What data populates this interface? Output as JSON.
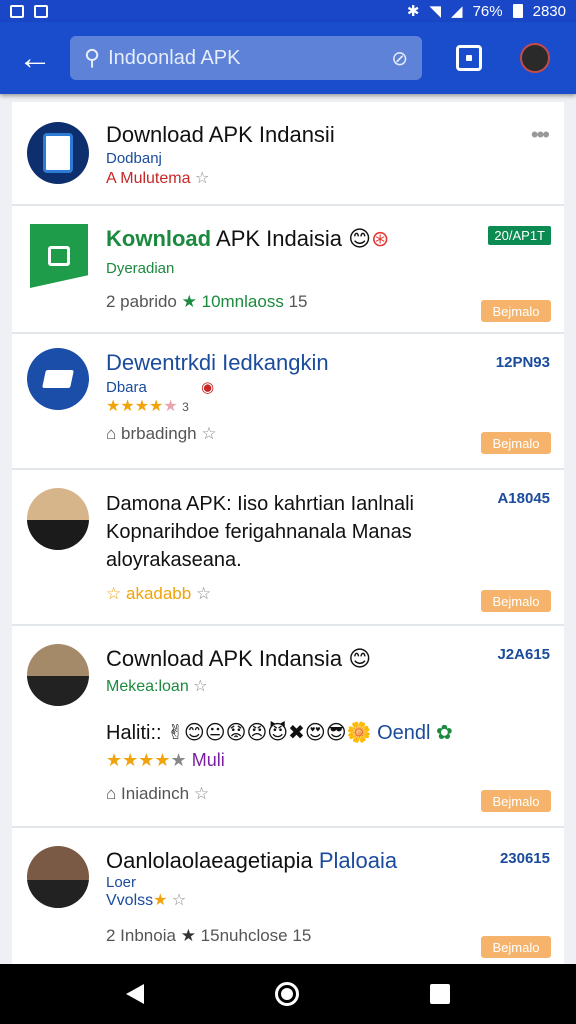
{
  "status": {
    "battery": "76%",
    "time": "2830"
  },
  "search": {
    "text": "Indoonlad APK"
  },
  "items": [
    {
      "title": "Download APK Indansii",
      "sub1": "Dodbanj",
      "sub2": "A Mulutema"
    },
    {
      "title_green": "Kownload",
      "title_rest": "APK Indaisia",
      "sub1": "Dyeradian",
      "meta_left": "2 pabrido",
      "meta_green": "10mnlaoss",
      "meta_right": "15",
      "badge": "20/AP1T",
      "button": "Bejmalo"
    },
    {
      "title": "Dewentrkdi Iedkangkin",
      "sub1": "Dbara",
      "rating_count": "3",
      "meta": "brbadingh",
      "badge": "12PN93",
      "button": "Bejmalo"
    },
    {
      "title_lines": [
        "Damona APK: Iiso kahrtian Ianlnali",
        "Kopnarihdoe ferigahnanala Manas",
        "aloyrakaseana."
      ],
      "meta": "akadabb",
      "badge": "A18045",
      "button": "Bejmalo"
    },
    {
      "title": "Cownload APK Indansia",
      "sub1": "Mekea:loan",
      "line2_text": "Haliti::",
      "line2_tail": "Oendl",
      "rating_label": "Muli",
      "meta": "Iniadinch",
      "badge": "J2A615",
      "button": "Bejmalo"
    },
    {
      "title_a": "Oanlolaolaeagetiapia",
      "title_b": "Plaloaia",
      "sub1": "Loer",
      "sub2": "Vvolss",
      "meta_left": "2 Inbnoia",
      "meta_mid": "15nuhclose",
      "meta_right": "15",
      "badge": "230615",
      "button": "Bejmalo"
    }
  ]
}
